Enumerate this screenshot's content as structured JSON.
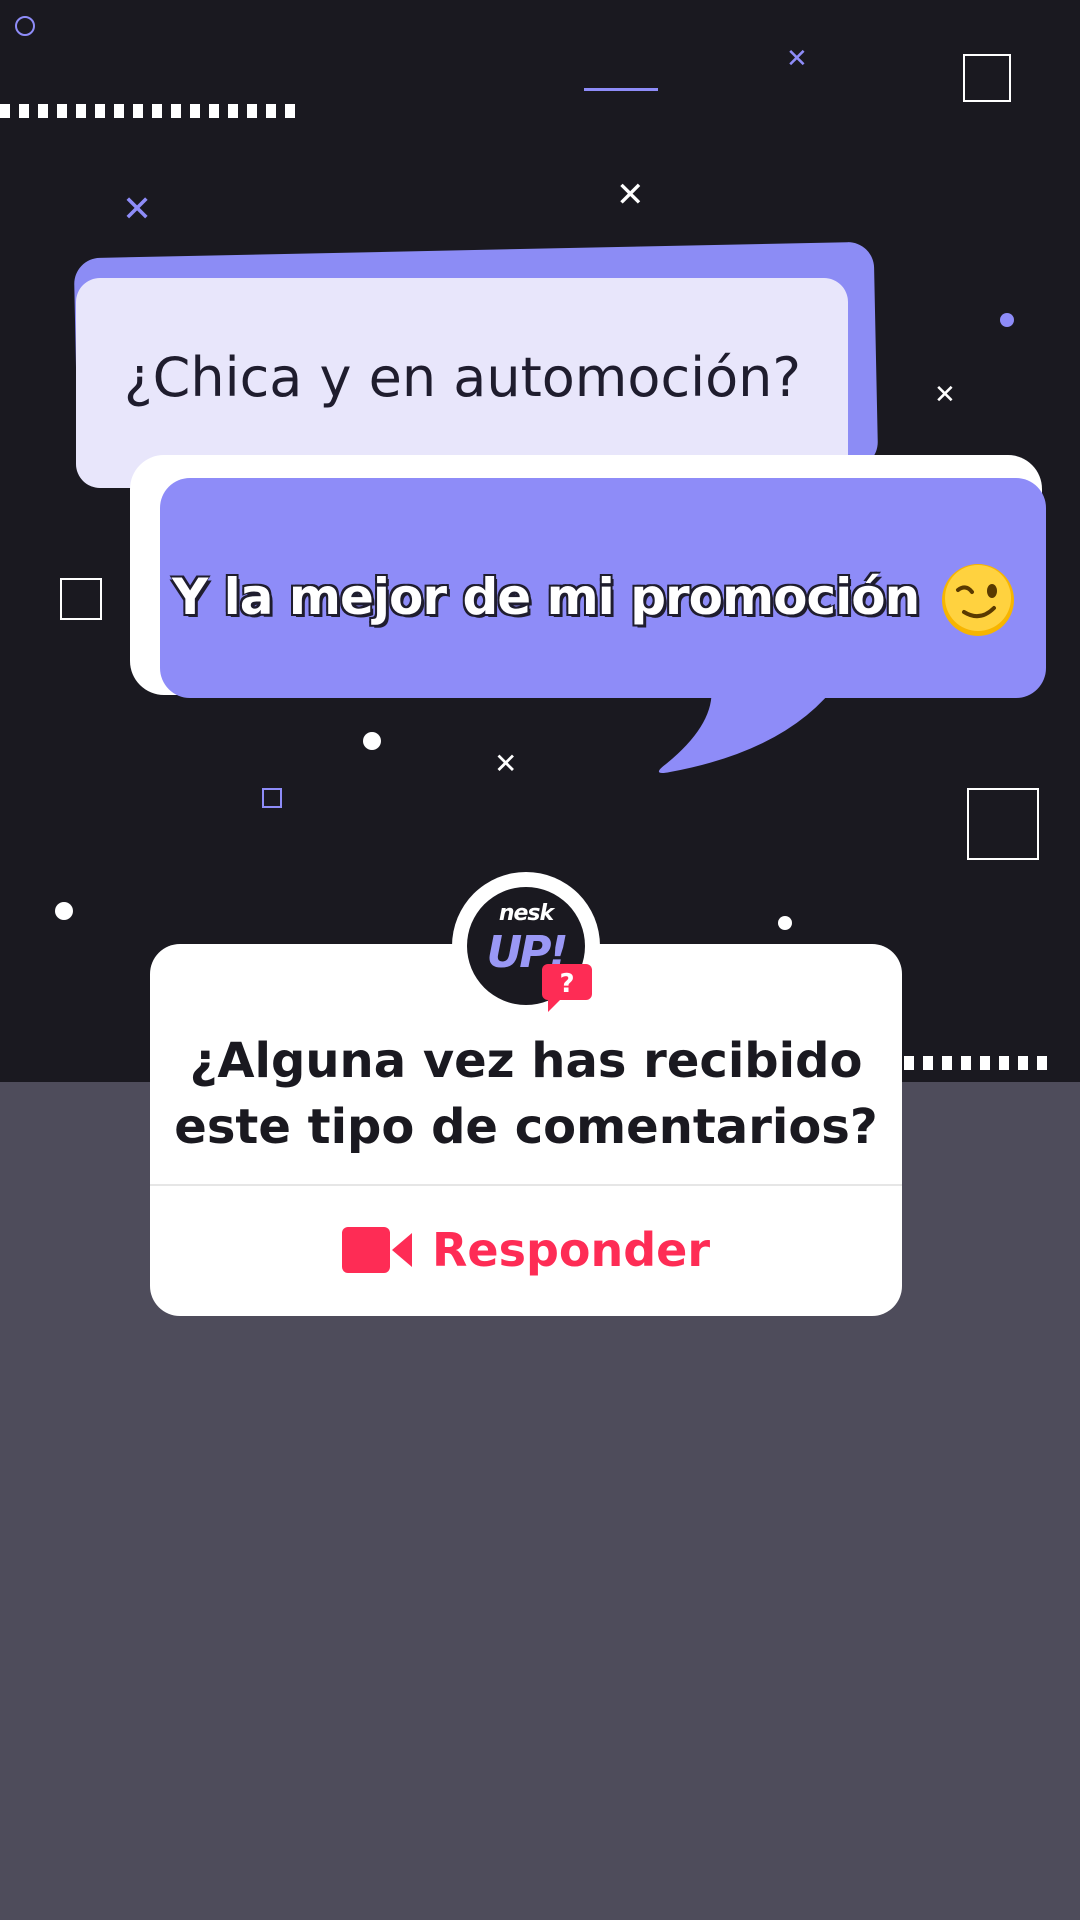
{
  "bubble_question": {
    "text": "¿Chica y en automoción?"
  },
  "bubble_answer": {
    "text": "Y la mejor de mi promoción",
    "emoji_icon": "winking-face-icon"
  },
  "question_card": {
    "avatar_logo": {
      "top": "nesk",
      "bottom": "UP!"
    },
    "badge_icon": "question-chat-icon",
    "question_lines": [
      "¿Alguna vez has recibido",
      "este tipo de comentarios?"
    ],
    "reply_label": "Responder",
    "reply_icon": "video-camera-icon"
  },
  "colors": {
    "dark_bg": "#1a1920",
    "bottom_bg": "#4e4c5b",
    "accent_purple": "#8e8cf8",
    "light_bubble": "#e8e6fb",
    "tiktok_red": "#fe2c55"
  }
}
